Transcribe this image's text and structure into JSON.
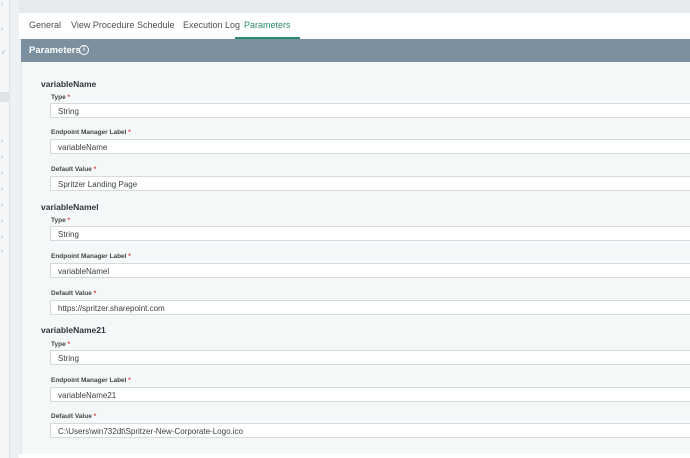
{
  "tabs": [
    {
      "label": "General"
    },
    {
      "label": "View Procedure"
    },
    {
      "label": "Schedule"
    },
    {
      "label": "Execution Log"
    },
    {
      "label": "Parameters"
    }
  ],
  "active_tab": "Parameters",
  "panel": {
    "title": "Parameters",
    "info_icon": "i"
  },
  "required_marker": "*",
  "variables": [
    {
      "name": "variableName",
      "type_label": "Type",
      "type_value": "String",
      "em_label": "Endpoint Manager Label",
      "em_value": "variableName",
      "default_label": "Default Value",
      "default_value": "Spritzer Landing Page"
    },
    {
      "name": "variableNamel",
      "type_label": "Type",
      "type_value": "String",
      "em_label": "Endpoint Manager Label",
      "em_value": "variableNamel",
      "default_label": "Default Value",
      "default_value": "https://spritzer.sharepoint.com"
    },
    {
      "name": "variableName21",
      "type_label": "Type",
      "type_value": "String",
      "em_label": "Endpoint Manager Label",
      "em_value": "variableName21",
      "default_label": "Default Value",
      "default_value": "C:\\Users\\win732dt\\Spritzer-New-Corporate-Logo.ico"
    }
  ],
  "colors": {
    "accent": "#2b8a6b",
    "header": "#7b8f9e",
    "required": "#d0352b"
  }
}
